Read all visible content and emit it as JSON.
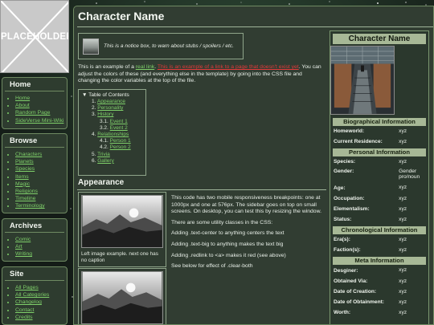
{
  "logo": {
    "text": "PLACEHOLDER"
  },
  "sidebar": {
    "sections": [
      {
        "title": "Home",
        "items": [
          "Home",
          "About",
          "Random Page",
          "SideVerse Mini-Wiki"
        ]
      },
      {
        "title": "Browse",
        "items": [
          "Characters",
          "Planets",
          "Species",
          "Items",
          "Magic",
          "Religions",
          "Timeline",
          "Terminology"
        ]
      },
      {
        "title": "Archives",
        "items": [
          "Comic",
          "Art",
          "Writing"
        ]
      },
      {
        "title": "Site",
        "items": [
          "All Pages",
          "All Categories",
          "Changelog",
          "Contact",
          "Credits"
        ]
      }
    ]
  },
  "page": {
    "title": "Character Name",
    "notice": "This is a notice box, to warn about stubs / spoilers / etc.",
    "intro": {
      "lead": "This is an example of a ",
      "link": "real link",
      "mid": ". ",
      "redlink": "This is an example of a link to a page that doesn't exist yet",
      "rest": ". You can adjust the colors of these (and everything else in the template) by going into the CSS file and changing the color variables at the top of the file."
    },
    "toc": {
      "title": "▼ Table of Contents",
      "entries": [
        {
          "num": "1.",
          "label": "Appearance",
          "level": 1
        },
        {
          "num": "2.",
          "label": "Personality",
          "level": 1
        },
        {
          "num": "3.",
          "label": "History",
          "level": 1
        },
        {
          "num": "3.1.",
          "label": "Event 1",
          "level": 2
        },
        {
          "num": "3.2.",
          "label": "Event 2",
          "level": 2
        },
        {
          "num": "4.",
          "label": "Relationships",
          "level": 1
        },
        {
          "num": "4.1.",
          "label": "Person 1",
          "level": 2
        },
        {
          "num": "4.2.",
          "label": "Person 2",
          "level": 2
        },
        {
          "num": "5.",
          "label": "Trivia",
          "level": 1
        },
        {
          "num": "6.",
          "label": "Gallery",
          "level": 1
        }
      ]
    },
    "section_heading": "Appearance",
    "figure_caption": "Left image example. next one has no caption",
    "paragraphs": [
      "This code has two mobile responsiveness breakpoints: one at 1000px and one at 576px. The sidebar goes on top on small screens. On desktop, you can test this by resizing the window.",
      "There are some utility classes in the CSS:",
      "Adding .text-center to anything centers the text",
      "Adding .text-big to anything makes the text big",
      "Adding .redlink to <a> makes it red (see above)",
      "See below for effect of .clear-both"
    ]
  },
  "infobox": {
    "title": "Character Name",
    "groups": [
      {
        "heading": "Biographical Information",
        "rows": [
          {
            "k": "Homeworld:",
            "v": "xyz"
          },
          {
            "k": "Current Residence:",
            "v": "xyz"
          }
        ]
      },
      {
        "heading": "Personal Information",
        "rows": [
          {
            "k": "Species:",
            "v": "xyz"
          },
          {
            "k": "Gender:",
            "v": "Gender pro/noun"
          },
          {
            "k": "Age:",
            "v": "xyz"
          },
          {
            "k": "Occupation:",
            "v": "xyz"
          },
          {
            "k": "Elementalism:",
            "v": "xyz"
          },
          {
            "k": "Status:",
            "v": "xyz"
          }
        ]
      },
      {
        "heading": "Chronological Information",
        "rows": [
          {
            "k": "Era(s):",
            "v": "xyz"
          },
          {
            "k": "Faction(s):",
            "v": "xyz"
          }
        ]
      },
      {
        "heading": "Meta Information",
        "rows": [
          {
            "k": "Desginer:",
            "v": "xyz"
          },
          {
            "k": "Obtained Via:",
            "v": "xyz"
          },
          {
            "k": "Date of Creation:",
            "v": "xyz"
          },
          {
            "k": "Date of Obtainment:",
            "v": "xyz"
          },
          {
            "k": "Worth:",
            "v": "xyz"
          }
        ]
      }
    ]
  }
}
